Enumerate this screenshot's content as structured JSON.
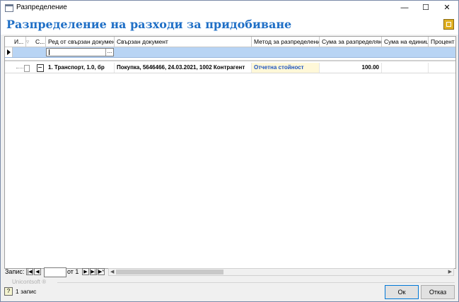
{
  "window": {
    "title": "Разпределение"
  },
  "header": {
    "title": "Разпределение на разходи за придобиване"
  },
  "columns": [
    "И...",
    "С...",
    "Ред от свързан документ",
    "Свързан документ",
    "Метод за разпределение",
    "Сума за разпределяне",
    "Сума на единица",
    "Процент"
  ],
  "rows": [
    {
      "line": "1. Транспорт, 1.0, бр",
      "document": "Покупка, 5646466, 24.03.2021, 1002 Контрагент",
      "method": "Отчетна стойност",
      "amount": "100.00",
      "unit_amount": "",
      "percent": ""
    }
  ],
  "filter_row": {
    "button_label": "..."
  },
  "navigator": {
    "label": "Запис:",
    "of_label": "от 1",
    "buttons": [
      "first",
      "prev",
      "next",
      "last",
      "new"
    ]
  },
  "brand": "Unicontsoft ®",
  "status": {
    "text": "1 запис"
  },
  "buttons": {
    "ok": "Ок",
    "cancel": "Отказ"
  }
}
